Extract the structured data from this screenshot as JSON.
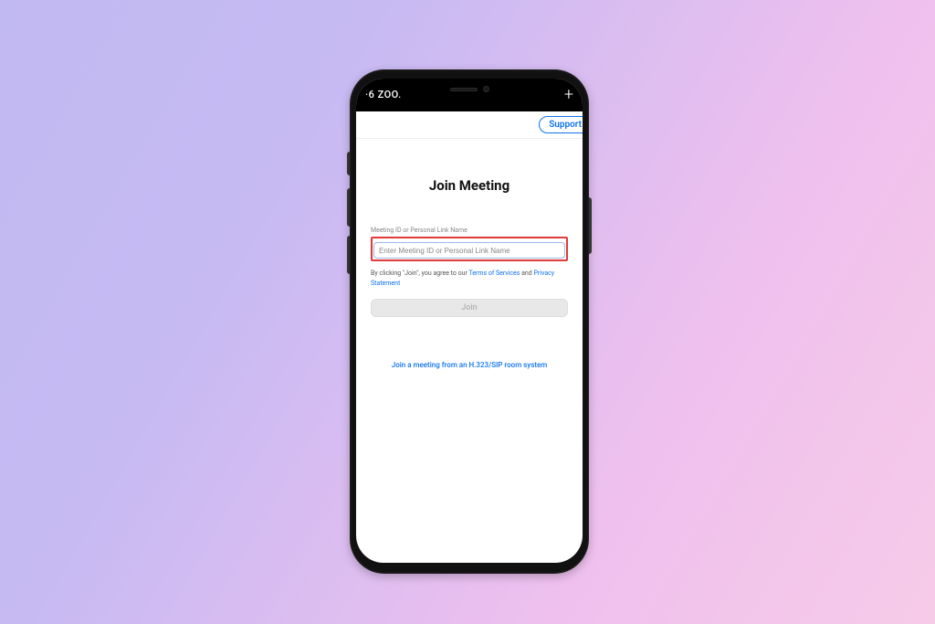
{
  "topbar": {
    "left_label": "·6  ZOO.",
    "plus": "+"
  },
  "support_label": "Support",
  "title": "Join Meeting",
  "field_label": "Meeting ID or Personal Link Name",
  "input_placeholder": "Enter Meeting ID or Personal Link Name",
  "agree": {
    "prefix": "By clicking \"Join\", you agree to our ",
    "tos": "Terms of Services",
    "and": " and ",
    "privacy": "Privacy Statement"
  },
  "join_label": "Join",
  "sip_link": "Join a meeting from an H.323/SIP room system"
}
